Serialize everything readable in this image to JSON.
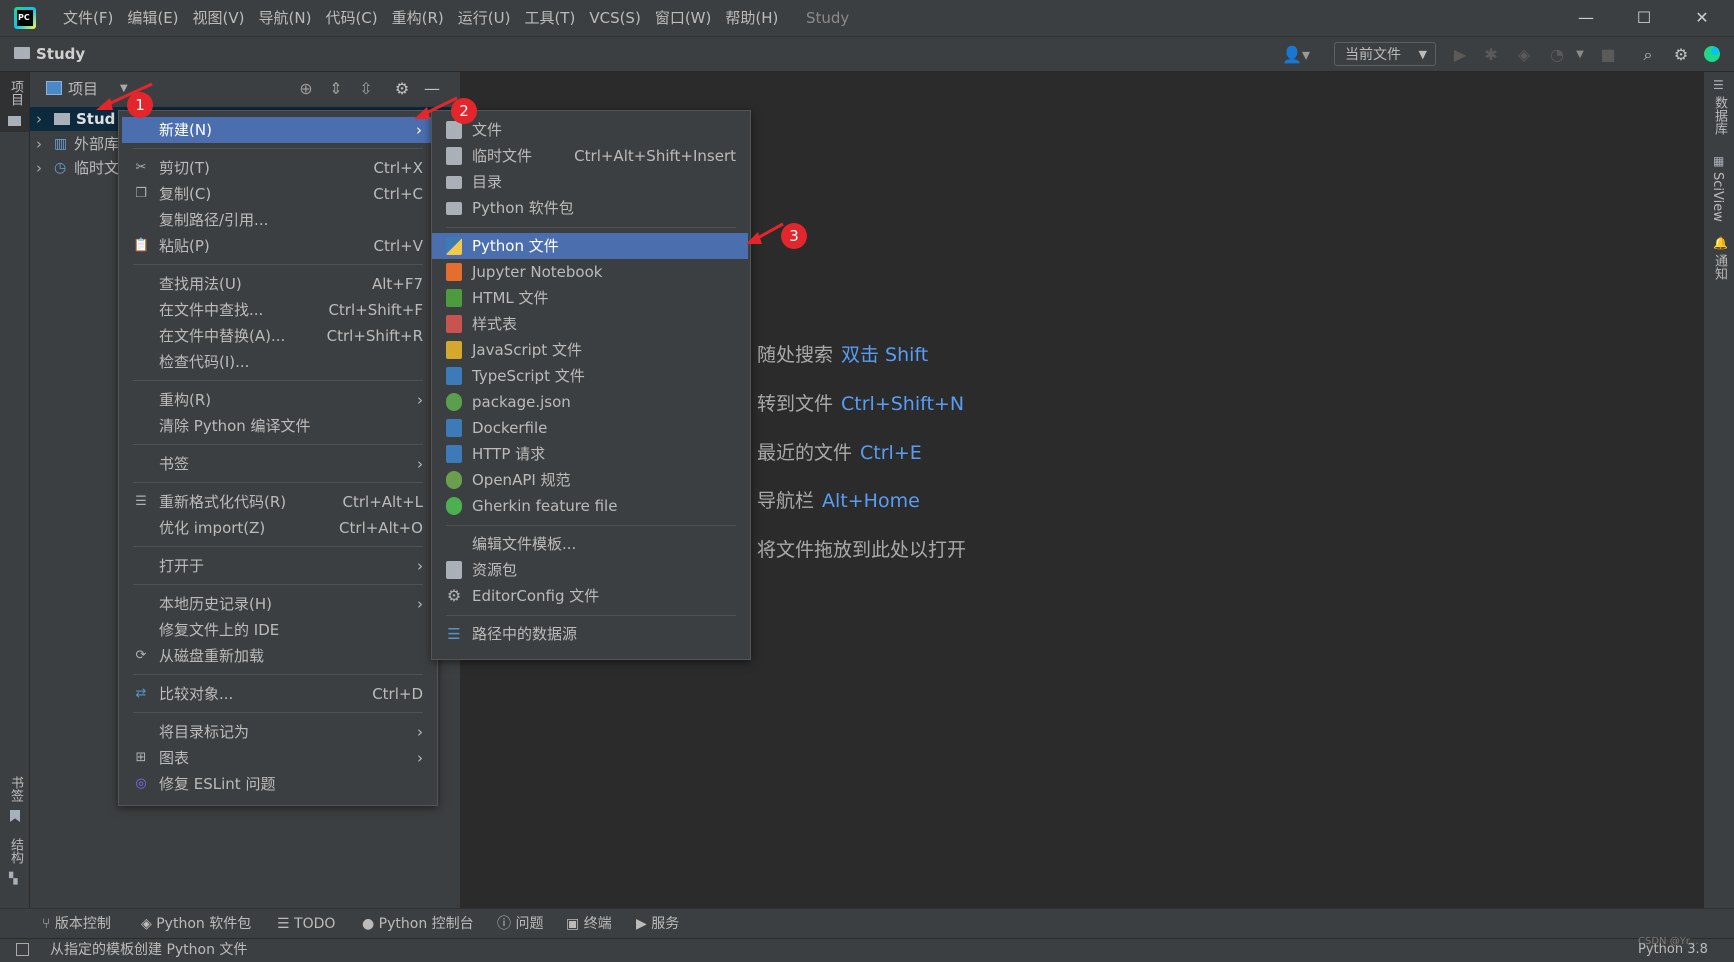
{
  "window": {
    "title": "Study",
    "menu": [
      "文件(F)",
      "编辑(E)",
      "视图(V)",
      "导航(N)",
      "代码(C)",
      "重构(R)",
      "运行(U)",
      "工具(T)",
      "VCS(S)",
      "窗口(W)",
      "帮助(H)"
    ],
    "minimize": "—",
    "maximize": "☐",
    "close": "✕"
  },
  "navbar": {
    "project": "Study",
    "run_config": "当前文件"
  },
  "left_strip": {
    "project_tab": "项目",
    "bookmarks_tab": "书签",
    "structure_tab": "结构"
  },
  "right_strip": {
    "database_tab": "数据库",
    "sciview_tab": "SciView",
    "notifications_tab": "通知"
  },
  "project_panel": {
    "title": "项目",
    "tree": [
      {
        "label": "Stud"
      },
      {
        "label": "外部库"
      },
      {
        "label": "临时文"
      }
    ]
  },
  "editor_hints": [
    {
      "label": "随处搜索",
      "key": "双击 Shift"
    },
    {
      "label": "转到文件",
      "key": "Ctrl+Shift+N"
    },
    {
      "label": "最近的文件",
      "key": "Ctrl+E"
    },
    {
      "label": "导航栏",
      "key": "Alt+Home"
    },
    {
      "label": "将文件拖放到此处以打开",
      "key": ""
    }
  ],
  "context_menu": {
    "items": [
      {
        "label": "新建(N)",
        "shortcut": "",
        "submenu": true,
        "highlighted": true,
        "icon": "none"
      },
      {
        "label": "剪切(T)",
        "shortcut": "Ctrl+X",
        "icon": "scissors-icon"
      },
      {
        "label": "复制(C)",
        "shortcut": "Ctrl+C",
        "icon": "copy-icon"
      },
      {
        "label": "复制路径/引用...",
        "shortcut": "",
        "icon": "none"
      },
      {
        "label": "粘贴(P)",
        "shortcut": "Ctrl+V",
        "icon": "paste-icon"
      },
      {
        "label": "查找用法(U)",
        "shortcut": "Alt+F7"
      },
      {
        "label": "在文件中查找...",
        "shortcut": "Ctrl+Shift+F"
      },
      {
        "label": "在文件中替换(A)...",
        "shortcut": "Ctrl+Shift+R"
      },
      {
        "label": "检查代码(I)...",
        "shortcut": ""
      },
      {
        "label": "重构(R)",
        "shortcut": "",
        "submenu": true
      },
      {
        "label": "清除 Python 编译文件",
        "shortcut": ""
      },
      {
        "label": "书签",
        "shortcut": "",
        "submenu": true
      },
      {
        "label": "重新格式化代码(R)",
        "shortcut": "Ctrl+Alt+L",
        "icon": "reformat-icon"
      },
      {
        "label": "优化 import(Z)",
        "shortcut": "Ctrl+Alt+O"
      },
      {
        "label": "打开于",
        "shortcut": "",
        "submenu": true
      },
      {
        "label": "本地历史记录(H)",
        "shortcut": "",
        "submenu": true
      },
      {
        "label": "修复文件上的 IDE",
        "shortcut": ""
      },
      {
        "label": "从磁盘重新加载",
        "shortcut": "",
        "icon": "reload-icon"
      },
      {
        "label": "比较对象...",
        "shortcut": "Ctrl+D",
        "icon": "compare-icon"
      },
      {
        "label": "将目录标记为",
        "shortcut": "",
        "submenu": true
      },
      {
        "label": "图表",
        "shortcut": "",
        "submenu": true,
        "icon": "diagram-icon"
      },
      {
        "label": "修复 ESLint 问题",
        "shortcut": "",
        "icon": "eslint-icon"
      }
    ]
  },
  "new_submenu": {
    "items": [
      {
        "label": "文件",
        "shortcut": "",
        "icon": "file-icon",
        "color": "#a9b0b8"
      },
      {
        "label": "临时文件",
        "shortcut": "Ctrl+Alt+Shift+Insert",
        "icon": "scratch-file-icon",
        "color": "#a9b0b8"
      },
      {
        "label": "目录",
        "shortcut": "",
        "icon": "folder-icon",
        "color": "#a9b0b8"
      },
      {
        "label": "Python 软件包",
        "shortcut": "",
        "icon": "package-icon",
        "color": "#a9b0b8"
      },
      {
        "label": "Python 文件",
        "shortcut": "",
        "icon": "python-file-icon",
        "color": "#3d7ab8",
        "highlighted": true
      },
      {
        "label": "Jupyter Notebook",
        "shortcut": "",
        "icon": "jupyter-icon",
        "color": "#e46e2e"
      },
      {
        "label": "HTML 文件",
        "shortcut": "",
        "icon": "html-file-icon",
        "color": "#4e9a3f"
      },
      {
        "label": "样式表",
        "shortcut": "",
        "icon": "css-file-icon",
        "color": "#c75450"
      },
      {
        "label": "JavaScript 文件",
        "shortcut": "",
        "icon": "js-file-icon",
        "color": "#d4a82c"
      },
      {
        "label": "TypeScript 文件",
        "shortcut": "",
        "icon": "ts-file-icon",
        "color": "#3d7ab8"
      },
      {
        "label": "package.json",
        "shortcut": "",
        "icon": "npm-icon",
        "color": "#5b9e4d"
      },
      {
        "label": "Dockerfile",
        "shortcut": "",
        "icon": "docker-icon",
        "color": "#3d7ab8"
      },
      {
        "label": "HTTP 请求",
        "shortcut": "",
        "icon": "http-request-icon",
        "color": "#3d7ab8"
      },
      {
        "label": "OpenAPI 规范",
        "shortcut": "",
        "icon": "openapi-icon",
        "color": "#6b9e4d"
      },
      {
        "label": "Gherkin feature file",
        "shortcut": "",
        "icon": "gherkin-icon",
        "color": "#4caf50"
      },
      {
        "label": "编辑文件模板...",
        "shortcut": "",
        "icon": "none",
        "color": ""
      },
      {
        "label": "资源包",
        "shortcut": "",
        "icon": "resource-bundle-icon",
        "color": "#a9b0b8"
      },
      {
        "label": "EditorConfig 文件",
        "shortcut": "",
        "icon": "gear-icon",
        "color": "#a9b0b8"
      },
      {
        "label": "路径中的数据源",
        "shortcut": "",
        "icon": "database-icon",
        "color": "#5592c7"
      }
    ]
  },
  "annotations": [
    "1",
    "2",
    "3"
  ],
  "bottom_tools": [
    {
      "label": "版本控制",
      "icon": "branch-icon"
    },
    {
      "label": "Python 软件包",
      "icon": "layers-icon"
    },
    {
      "label": "TODO",
      "icon": "list-icon"
    },
    {
      "label": "Python 控制台",
      "icon": "python-icon"
    },
    {
      "label": "问题",
      "icon": "info-icon"
    },
    {
      "label": "终端",
      "icon": "terminal-icon"
    },
    {
      "label": "服务",
      "icon": "play-circle-icon"
    }
  ],
  "status": {
    "message": "从指定的模板创建 Python 文件",
    "interpreter": "Python 3.8",
    "watermark": "CSDN @Yr..."
  }
}
